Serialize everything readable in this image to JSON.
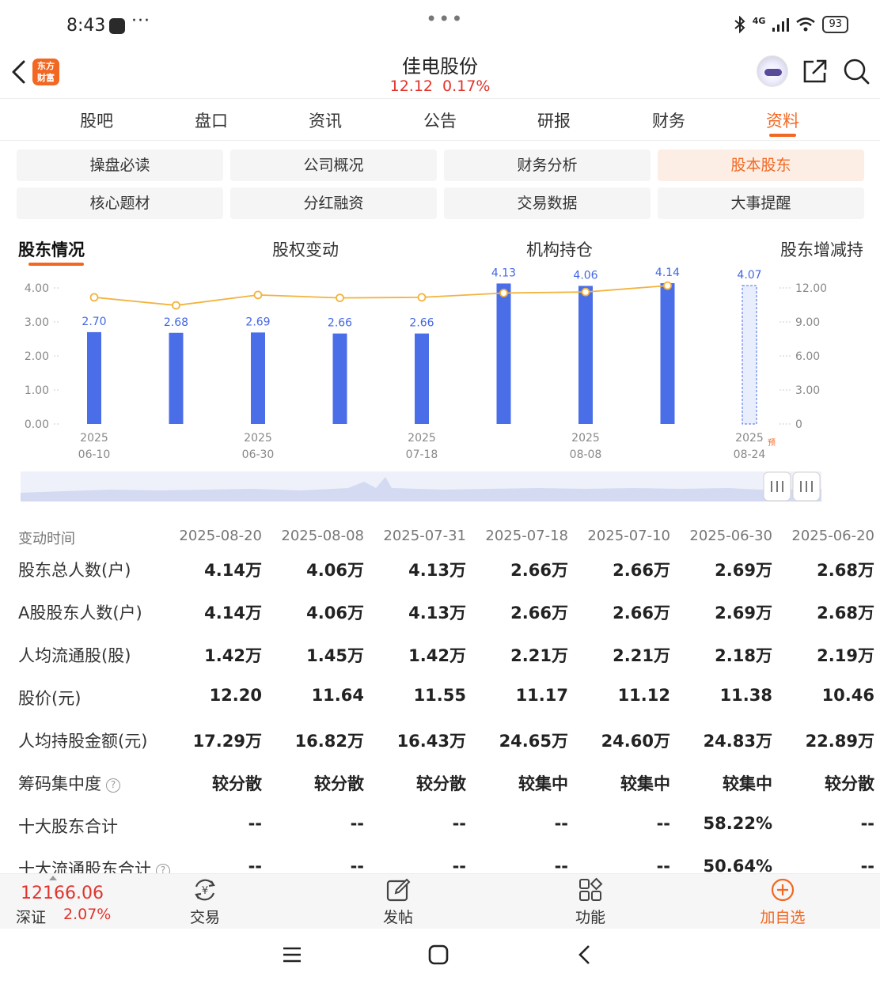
{
  "status_bar": {
    "time": "8:43",
    "dots": "•••",
    "network": "4G",
    "battery": "93"
  },
  "header": {
    "title": "佳电股份",
    "price": "12.12",
    "change_pct": "0.17%",
    "logo_text_1": "东方",
    "logo_text_2": "财富"
  },
  "main_tabs": [
    {
      "label": "股吧"
    },
    {
      "label": "盘口"
    },
    {
      "label": "资讯"
    },
    {
      "label": "公告"
    },
    {
      "label": "研报"
    },
    {
      "label": "财务"
    },
    {
      "label": "资料",
      "active": true
    }
  ],
  "grid_buttons": [
    {
      "label": "操盘必读"
    },
    {
      "label": "公司概况"
    },
    {
      "label": "财务分析"
    },
    {
      "label": "股本股东",
      "active": true
    },
    {
      "label": "核心题材"
    },
    {
      "label": "分红融资"
    },
    {
      "label": "交易数据"
    },
    {
      "label": "大事提醒"
    }
  ],
  "sub_tabs": [
    {
      "label": "股东情况",
      "active": true
    },
    {
      "label": "股权变动"
    },
    {
      "label": "机构持仓"
    },
    {
      "label": "股东增减持"
    }
  ],
  "chart_data": {
    "type": "bar",
    "categories": [
      "2025-06-10",
      "2025-06-20",
      "2025-06-30",
      "2025-07-10",
      "2025-07-18",
      "2025-07-31",
      "2025-08-08",
      "2025-08-20",
      "2025-08-24"
    ],
    "x_tick_labels": [
      {
        "year": "2025",
        "date": "06-10"
      },
      {
        "year": "2025",
        "date": "06-30"
      },
      {
        "year": "2025",
        "date": "07-18"
      },
      {
        "year": "2025",
        "date": "08-08"
      },
      {
        "year": "2025",
        "date": "08-24",
        "badge": "预"
      }
    ],
    "bars": [
      2.7,
      2.68,
      2.69,
      2.66,
      2.66,
      4.13,
      4.06,
      4.14,
      4.07
    ],
    "bar_labels": [
      "2.70",
      "2.68",
      "2.69",
      "2.66",
      "2.66",
      "4.13",
      "4.06",
      "4.14",
      "4.07"
    ],
    "bar_last_is_forecast": true,
    "line": [
      11.17,
      10.46,
      11.38,
      11.12,
      11.17,
      11.55,
      11.64,
      12.2
    ],
    "y_left_ticks": [
      "4.00",
      "3.00",
      "2.00",
      "1.00",
      "0.00"
    ],
    "y_right_ticks": [
      "12.00",
      "9.00",
      "6.00",
      "3.00",
      "0"
    ],
    "ylim_left": [
      0,
      4
    ],
    "ylim_right": [
      0,
      12
    ],
    "bar_color": "#4a6ee8",
    "line_color": "#f2b33d",
    "grid": false
  },
  "table": {
    "header_label": "变动时间",
    "dates": [
      "2025-08-20",
      "2025-08-08",
      "2025-07-31",
      "2025-07-18",
      "2025-07-10",
      "2025-06-30",
      "2025-06-20"
    ],
    "rows": [
      {
        "label": "股东总人数(户)",
        "values": [
          "4.14万",
          "4.06万",
          "4.13万",
          "2.66万",
          "2.66万",
          "2.69万",
          "2.68万"
        ]
      },
      {
        "label": "A股股东人数(户)",
        "values": [
          "4.14万",
          "4.06万",
          "4.13万",
          "2.66万",
          "2.66万",
          "2.69万",
          "2.68万"
        ]
      },
      {
        "label": "人均流通股(股)",
        "values": [
          "1.42万",
          "1.45万",
          "1.42万",
          "2.21万",
          "2.21万",
          "2.18万",
          "2.19万"
        ]
      },
      {
        "label": "股价(元)",
        "values": [
          "12.20",
          "11.64",
          "11.55",
          "11.17",
          "11.12",
          "11.38",
          "10.46"
        ]
      },
      {
        "label": "人均持股金额(元)",
        "values": [
          "17.29万",
          "16.82万",
          "16.43万",
          "24.65万",
          "24.60万",
          "24.83万",
          "22.89万"
        ]
      },
      {
        "label": "筹码集中度",
        "help": true,
        "values": [
          "较分散",
          "较分散",
          "较分散",
          "较集中",
          "较集中",
          "较集中",
          "较分散"
        ]
      },
      {
        "label": "十大股东合计",
        "values": [
          "--",
          "--",
          "--",
          "--",
          "--",
          "58.22%",
          "--"
        ]
      },
      {
        "label": "十大流通股东合计",
        "help": true,
        "values": [
          "--",
          "--",
          "--",
          "--",
          "--",
          "50.64%",
          "--"
        ]
      }
    ]
  },
  "bottom_bar": {
    "index_value": "12166.06",
    "index_name": "深证",
    "index_change": "2.07%",
    "items": [
      {
        "label": "交易",
        "icon": "trade-icon"
      },
      {
        "label": "发帖",
        "icon": "post-icon"
      },
      {
        "label": "功能",
        "icon": "apps-icon"
      },
      {
        "label": "加自选",
        "icon": "add-watchlist-icon"
      }
    ]
  },
  "colors": {
    "accent": "#f26822",
    "up": "#e0342c",
    "bar": "#4a6ee8",
    "line": "#f2b33d"
  }
}
